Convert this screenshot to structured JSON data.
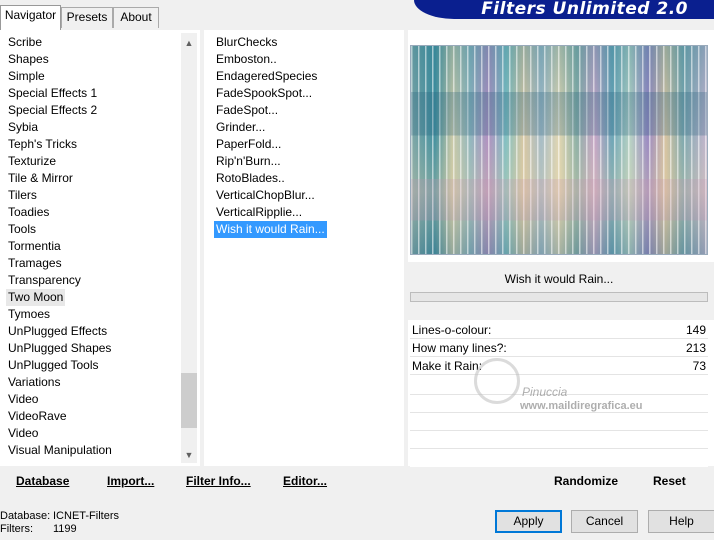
{
  "tabs": [
    {
      "label": "Navigator",
      "active": true
    },
    {
      "label": "Presets",
      "active": false
    },
    {
      "label": "About",
      "active": false
    }
  ],
  "banner": "Filters Unlimited 2.0",
  "categories": [
    "Scribe",
    "Shapes",
    "Simple",
    "Special Effects 1",
    "Special Effects 2",
    "Sybia",
    "Teph's Tricks",
    "Texturize",
    "Tile & Mirror",
    "Tilers",
    "Toadies",
    "Tools",
    "Tormentia",
    "Tramages",
    "Transparency",
    "Two Moon",
    "Tymoes",
    "UnPlugged Effects",
    "UnPlugged Shapes",
    "UnPlugged Tools",
    "Variations",
    "Video",
    "VideoRave",
    "Video",
    "Visual Manipulation"
  ],
  "selected_category": "Two Moon",
  "filters": [
    "BlurChecks",
    "Emboston..",
    "EndageredSpecies",
    "FadeSpookSpot...",
    "FadeSpot...",
    "Grinder...",
    "PaperFold...",
    "Rip'n'Burn...",
    "RotoBlades..",
    "VerticalChopBlur...",
    "VerticalRipplie...",
    "Wish it would Rain..."
  ],
  "selected_filter": "Wish it would Rain...",
  "filter_title": "Wish it would Rain...",
  "params": [
    {
      "label": "Lines-o-colour:",
      "value": "149"
    },
    {
      "label": "How many lines?:",
      "value": "213"
    },
    {
      "label": "Make it Rain:",
      "value": "73"
    }
  ],
  "watermark": {
    "title": "Pinuccia",
    "url": "www.maildiregrafica.eu"
  },
  "bottom_buttons": {
    "database": "Database",
    "import": "Import...",
    "filter_info": "Filter Info...",
    "editor": "Editor...",
    "randomize": "Randomize",
    "reset": "Reset"
  },
  "status": {
    "database_label": "Database:",
    "database_value": "ICNET-Filters",
    "filters_label": "Filters:",
    "filters_value": "1199"
  },
  "dialog_buttons": {
    "apply": "Apply",
    "cancel": "Cancel",
    "help": "Help"
  },
  "icons": {
    "scroll_up": "chevron-up-icon",
    "scroll_down": "chevron-down-icon"
  },
  "colors": {
    "selection": "#3399ff",
    "banner": "#0a1f8f",
    "default_button_border": "#0078d7"
  }
}
